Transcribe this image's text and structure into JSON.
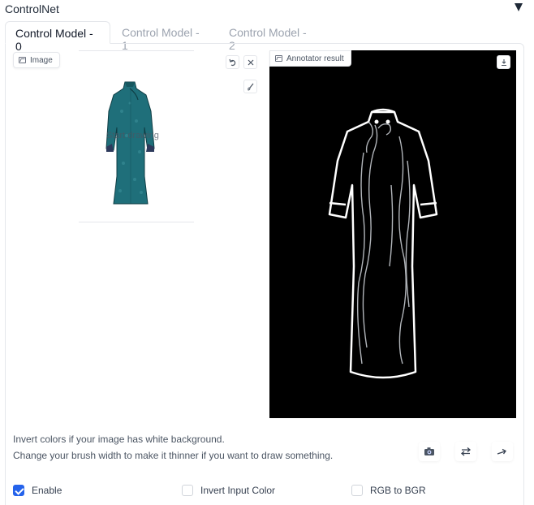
{
  "header": {
    "title": "ControlNet"
  },
  "tabs": [
    {
      "label": "Control Model - 0",
      "active": true
    },
    {
      "label": "Control Model - 1",
      "active": false
    },
    {
      "label": "Control Model - 2",
      "active": false
    }
  ],
  "image_input": {
    "label": "Image",
    "placeholder": "Start drawing",
    "tools": [
      "undo-icon",
      "close-icon",
      "brush-icon"
    ]
  },
  "annotator": {
    "label": "Annotator result",
    "download_icon": "download-icon"
  },
  "info": {
    "line1": "Invert colors if your image has white background.",
    "line2": "Change your brush width to make it thinner if you want to draw something."
  },
  "actions": [
    "camera-icon",
    "swap-icon",
    "arrow-up-right-icon"
  ],
  "options": {
    "enable": {
      "label": "Enable",
      "checked": true
    },
    "invert": {
      "label": "Invert Input Color",
      "checked": false
    },
    "rgb_bgr": {
      "label": "RGB to BGR",
      "checked": false
    }
  },
  "colors": {
    "accent": "#2563eb",
    "dress": "#1f6f7a",
    "result_bg": "#000000"
  }
}
